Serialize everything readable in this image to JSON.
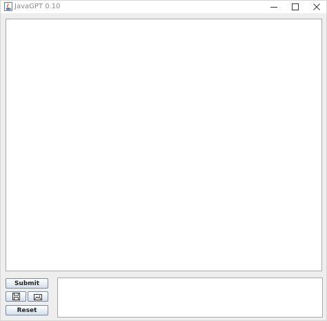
{
  "window": {
    "title": "JavaGPT 0.10",
    "icons": {
      "app": "java-cup-icon",
      "minimize": "minimize-icon",
      "maximize": "maximize-icon",
      "close": "close-icon"
    }
  },
  "controls": {
    "submit_label": "Submit",
    "reset_label": "Reset",
    "save_icon": "floppy-disk-icon",
    "image_icon": "image-icon"
  },
  "output": {
    "text": ""
  },
  "input": {
    "value": ""
  }
}
